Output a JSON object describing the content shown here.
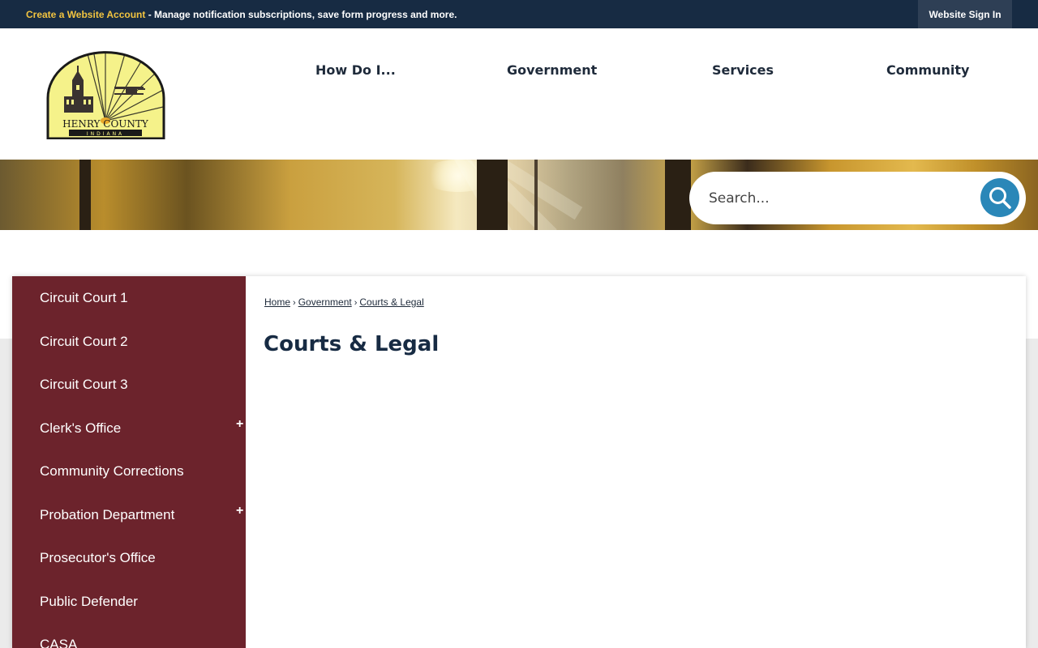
{
  "topbar": {
    "account_link": "Create a Website Account",
    "message": " - Manage notification subscriptions, save form progress and more.",
    "signin_label": "Website Sign In"
  },
  "logo": {
    "line1": "HENRY COUNTY",
    "line2": "INDIANA",
    "colors": {
      "sun": "#f5f28a",
      "ink": "#1a1a1a",
      "flare": "#e9a92a"
    }
  },
  "nav": {
    "items": [
      "How Do I...",
      "Government",
      "Services",
      "Community"
    ]
  },
  "search": {
    "placeholder": "Search..."
  },
  "sidebar": {
    "items": [
      {
        "label": "Circuit Court 1",
        "expandable": false
      },
      {
        "label": "Circuit Court 2",
        "expandable": false
      },
      {
        "label": "Circuit Court 3",
        "expandable": false
      },
      {
        "label": "Clerk's Office",
        "expandable": true
      },
      {
        "label": "Community Corrections",
        "expandable": false
      },
      {
        "label": "Probation Department",
        "expandable": true
      },
      {
        "label": "Prosecutor's Office",
        "expandable": false
      },
      {
        "label": "Public Defender",
        "expandable": false
      },
      {
        "label": "CASA",
        "expandable": false
      }
    ],
    "expand_glyph": "+"
  },
  "breadcrumb": {
    "items": [
      "Home",
      "Government",
      "Courts & Legal"
    ],
    "separator": "›"
  },
  "page": {
    "title": "Courts & Legal"
  },
  "colors": {
    "topbar": "#172b43",
    "account_link": "#f2c440",
    "sidebar": "#6c232c",
    "search_button": "#2a87b8",
    "title": "#172b43"
  }
}
